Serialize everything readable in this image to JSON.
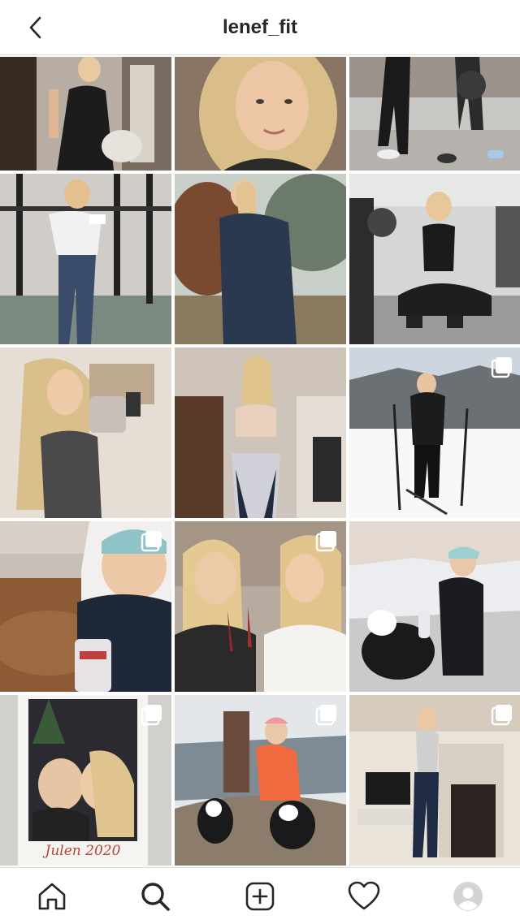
{
  "header": {
    "title": "lenef_fit",
    "back_icon": "chevron-left-icon"
  },
  "grid": {
    "posts": [
      {
        "alt": "photo",
        "multi": false
      },
      {
        "alt": "photo",
        "multi": false
      },
      {
        "alt": "photo",
        "multi": false
      },
      {
        "alt": "photo",
        "multi": false
      },
      {
        "alt": "photo",
        "multi": false
      },
      {
        "alt": "photo",
        "multi": false
      },
      {
        "alt": "photo",
        "multi": false
      },
      {
        "alt": "photo",
        "multi": false
      },
      {
        "alt": "photo",
        "multi": true
      },
      {
        "alt": "photo",
        "multi": true
      },
      {
        "alt": "photo",
        "multi": true
      },
      {
        "alt": "photo",
        "multi": false
      },
      {
        "alt": "photo",
        "multi": true
      },
      {
        "alt": "photo",
        "multi": true
      },
      {
        "alt": "photo",
        "multi": true
      }
    ],
    "polaroid_caption": "Julen 2020"
  },
  "tabbar": {
    "icons": [
      "home-icon",
      "search-icon",
      "add-post-icon",
      "heart-icon",
      "profile-avatar-icon"
    ]
  },
  "colors": {
    "text": "#262626",
    "border": "#dbdbdb",
    "background": "#ffffff"
  }
}
